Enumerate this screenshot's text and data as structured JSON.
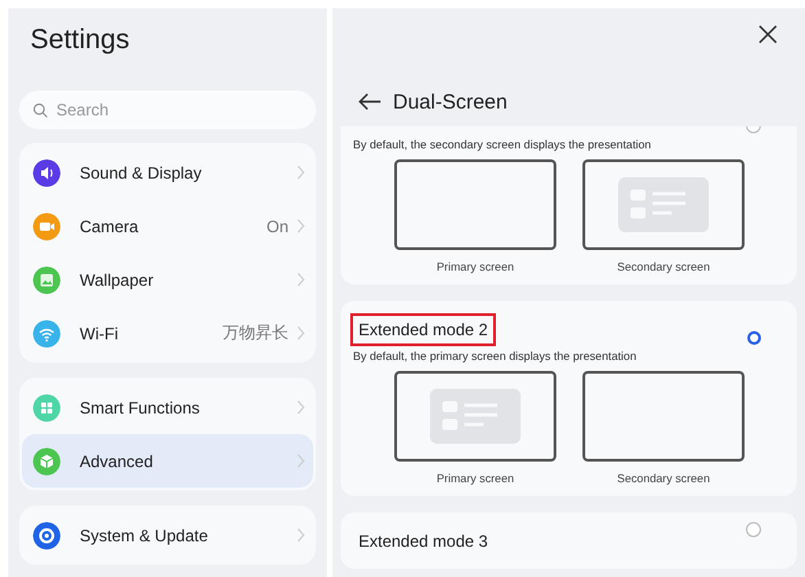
{
  "sidebar": {
    "title": "Settings",
    "search": {
      "placeholder": "Search"
    },
    "groups": [
      {
        "items": [
          {
            "kind": "sound",
            "color": "#5a3be6",
            "label": "Sound & Display",
            "selected": false
          },
          {
            "kind": "camera",
            "color": "#f39a12",
            "label": "Camera",
            "value": "On",
            "selected": false
          },
          {
            "kind": "wallpaper",
            "color": "#4cc551",
            "label": "Wallpaper",
            "selected": false
          },
          {
            "kind": "wifi",
            "color": "#39b4ea",
            "label": "Wi-Fi",
            "value": "万物昇长",
            "selected": false
          }
        ]
      },
      {
        "items": [
          {
            "kind": "grid",
            "color": "#4fd6a6",
            "label": "Smart Functions",
            "selected": false
          },
          {
            "kind": "cube",
            "color": "#4cc551",
            "label": "Advanced",
            "selected": true
          }
        ]
      },
      {
        "items": [
          {
            "kind": "gear",
            "color": "#1f63e6",
            "label": "System & Update",
            "selected": false
          }
        ]
      }
    ]
  },
  "detail": {
    "title": "Dual-Screen",
    "modes": [
      {
        "description": "By default, the secondary screen displays the presentation",
        "selected": false,
        "screens": [
          {
            "label": "Primary screen",
            "presentation": false
          },
          {
            "label": "Secondary screen",
            "presentation": true
          }
        ]
      },
      {
        "title": "Extended mode 2",
        "description": "By default, the primary screen displays the presentation",
        "selected": true,
        "highlighted": true,
        "screens": [
          {
            "label": "Primary screen",
            "presentation": true
          },
          {
            "label": "Secondary screen",
            "presentation": false
          }
        ]
      },
      {
        "title": "Extended mode 3",
        "selected": false,
        "highlighted": false
      }
    ]
  }
}
